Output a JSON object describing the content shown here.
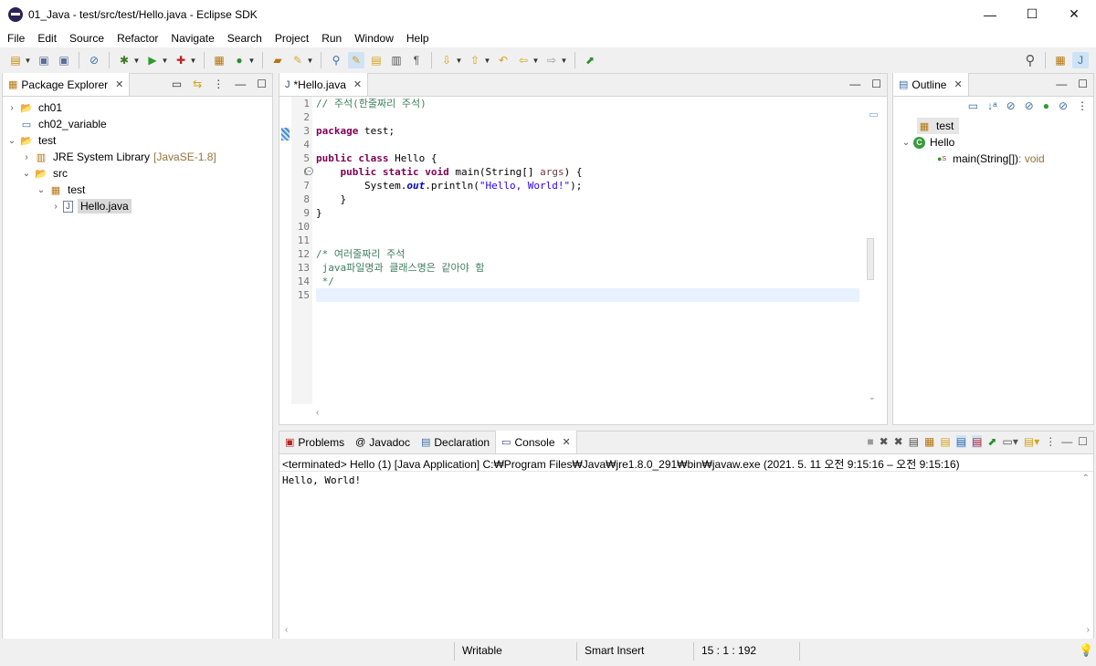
{
  "window": {
    "title": "01_Java - test/src/test/Hello.java - Eclipse SDK",
    "minimize": "—",
    "maximize": "☐",
    "close": "✕"
  },
  "menu": [
    "File",
    "Edit",
    "Source",
    "Refactor",
    "Navigate",
    "Search",
    "Project",
    "Run",
    "Window",
    "Help"
  ],
  "package_explorer": {
    "tab": "Package Explorer",
    "tree": [
      {
        "label": "ch01",
        "decor": ""
      },
      {
        "label": "ch02_variable",
        "decor": ""
      },
      {
        "label": "test",
        "decor": ""
      },
      {
        "label": "JRE System Library",
        "decor": "[JavaSE-1.8]"
      },
      {
        "label": "src",
        "decor": ""
      },
      {
        "label": "test",
        "decor": ""
      },
      {
        "label": "Hello.java",
        "decor": ""
      }
    ]
  },
  "editor": {
    "tab": "*Hello.java",
    "line_numbers": [
      "1",
      "2",
      "3",
      "4",
      "5",
      "6",
      "7",
      "8",
      "9",
      "10",
      "11",
      "12",
      "13",
      "14",
      "15"
    ],
    "lines": {
      "l1": "// 주석(한줄짜리 주석)",
      "l3_kw": "package",
      "l3_rest": " test;",
      "l5_kw1": "public",
      "l5_kw2": "class",
      "l5_rest": " Hello {",
      "l6_indent": "    ",
      "l6_kw1": "public",
      "l6_kw2": "static",
      "l6_kw3": "void",
      "l6_rest": " main(String[] ",
      "l6_arg": "args",
      "l6_end": ") {",
      "l7_pre": "        System.",
      "l7_out": "out",
      "l7_mid": ".println(",
      "l7_str": "\"Hello, World!\"",
      "l7_end": ");",
      "l8": "    }",
      "l9": "}",
      "l12": "/* 여러줄짜리 주석",
      "l13": " java파일명과 클래스명은 같아야 함",
      "l14": " */"
    }
  },
  "outline": {
    "tab": "Outline",
    "items": [
      {
        "label": "test",
        "type": ""
      },
      {
        "label": "Hello",
        "type": ""
      },
      {
        "label": "main(String[])",
        "type": " : void"
      }
    ]
  },
  "bottom": {
    "tabs": [
      "Problems",
      "Javadoc",
      "Declaration",
      "Console"
    ],
    "console_header": "<terminated> Hello (1) [Java Application] C:₩Program Files₩Java₩jre1.8.0_291₩bin₩javaw.exe  (2021. 5. 11 오전 9:15:16 – 오전 9:15:16)",
    "console_output": "Hello, World!"
  },
  "status": {
    "writable": "Writable",
    "insert": "Smart Insert",
    "position": "15 : 1 : 192"
  },
  "colors": {
    "keyword": "#7f0055",
    "comment": "#3f7f5f",
    "string": "#2a00ff",
    "field": "#0000c0",
    "selection": "#e8f2fe"
  }
}
